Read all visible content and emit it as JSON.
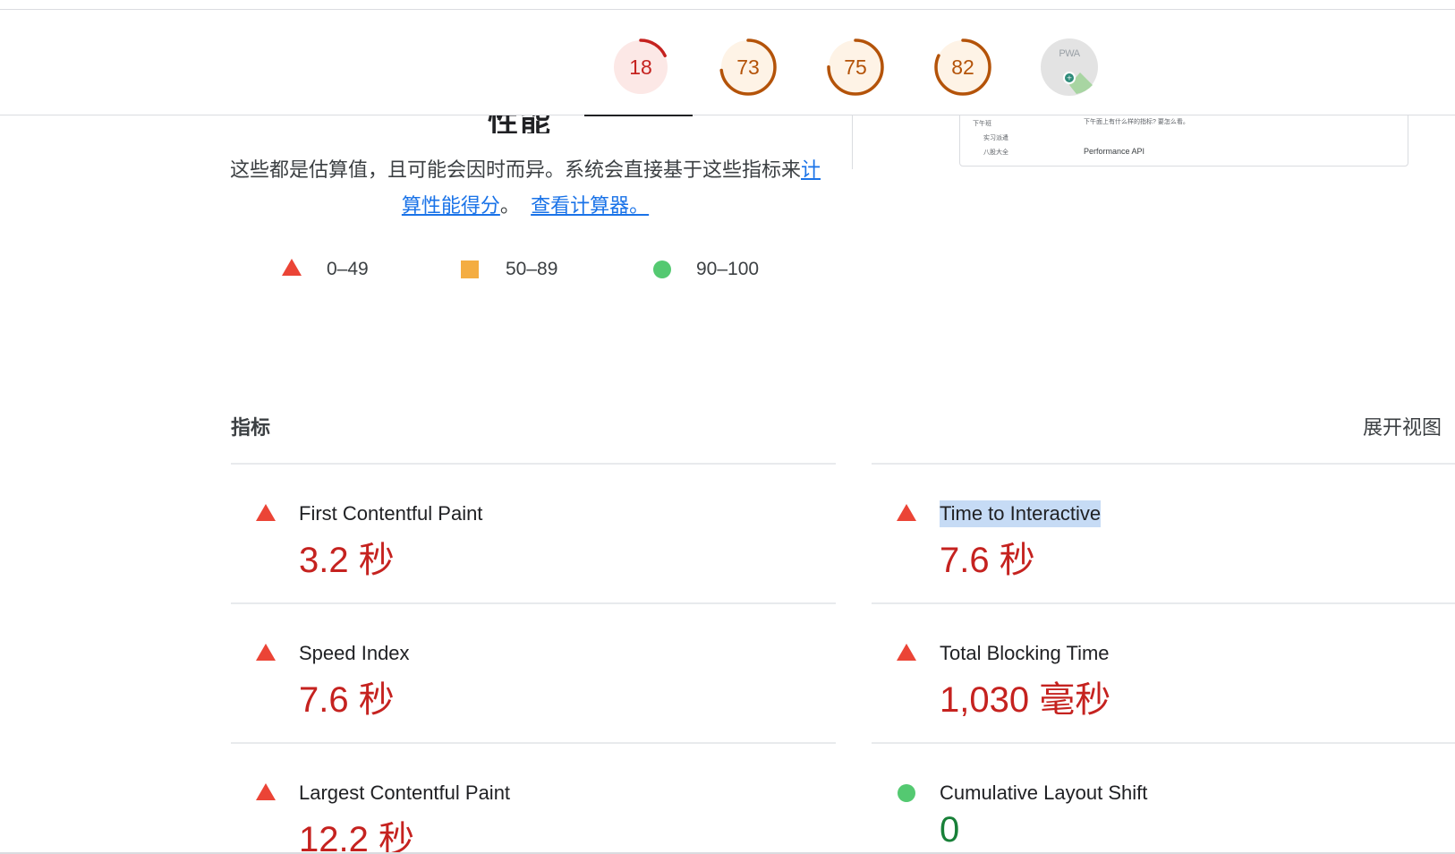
{
  "header": {
    "scores": [
      {
        "value": "18",
        "fraction": 0.18,
        "color": "#c5221f",
        "track": "#fce8e6",
        "name": "score-gauge-performance"
      },
      {
        "value": "73",
        "fraction": 0.73,
        "color": "#b45309",
        "track": "#fef3e6",
        "name": "score-gauge-accessibility"
      },
      {
        "value": "75",
        "fraction": 0.75,
        "color": "#b45309",
        "track": "#fef3e6",
        "name": "score-gauge-best-practices"
      },
      {
        "value": "82",
        "fraction": 0.82,
        "color": "#b45309",
        "track": "#fef3e6",
        "name": "score-gauge-seo"
      }
    ],
    "pwa_label": "PWA"
  },
  "category_title": "性能",
  "description": {
    "text1": "这些都是估算值，且可能会因时而异。系统会直接基于这些指标来",
    "link1": "计算性能得分",
    "text2": "。",
    "link2": "查看计算器。"
  },
  "legend": {
    "fail": "0–49",
    "average": "50–89",
    "pass": "90–100"
  },
  "thumbnail": {
    "row1_left": "下午班",
    "row2_left": "实习派遣",
    "row3_left": "八股大全",
    "row1_right": "下午面上有什么样的指标? 要怎么看。",
    "row3_right": "Performance API"
  },
  "metrics_section": {
    "title": "指标",
    "expand_label": "展开视图"
  },
  "metrics": [
    {
      "name": "First Contentful Paint",
      "value": "3.2 秒",
      "status": "fail"
    },
    {
      "name": "Time to Interactive",
      "value": "7.6 秒",
      "status": "fail"
    },
    {
      "name": "Speed Index",
      "value": "7.6 秒",
      "status": "fail"
    },
    {
      "name": "Total Blocking Time",
      "value": "1,030 毫秒",
      "status": "fail"
    },
    {
      "name": "Largest Contentful Paint",
      "value": "12.2 秒",
      "status": "fail"
    },
    {
      "name": "Cumulative Layout Shift",
      "value": "0",
      "status": "pass"
    }
  ],
  "colors": {
    "fail": "#eb4436",
    "average": "#f4ad42",
    "pass": "#54c971",
    "link": "#1a73e8"
  }
}
